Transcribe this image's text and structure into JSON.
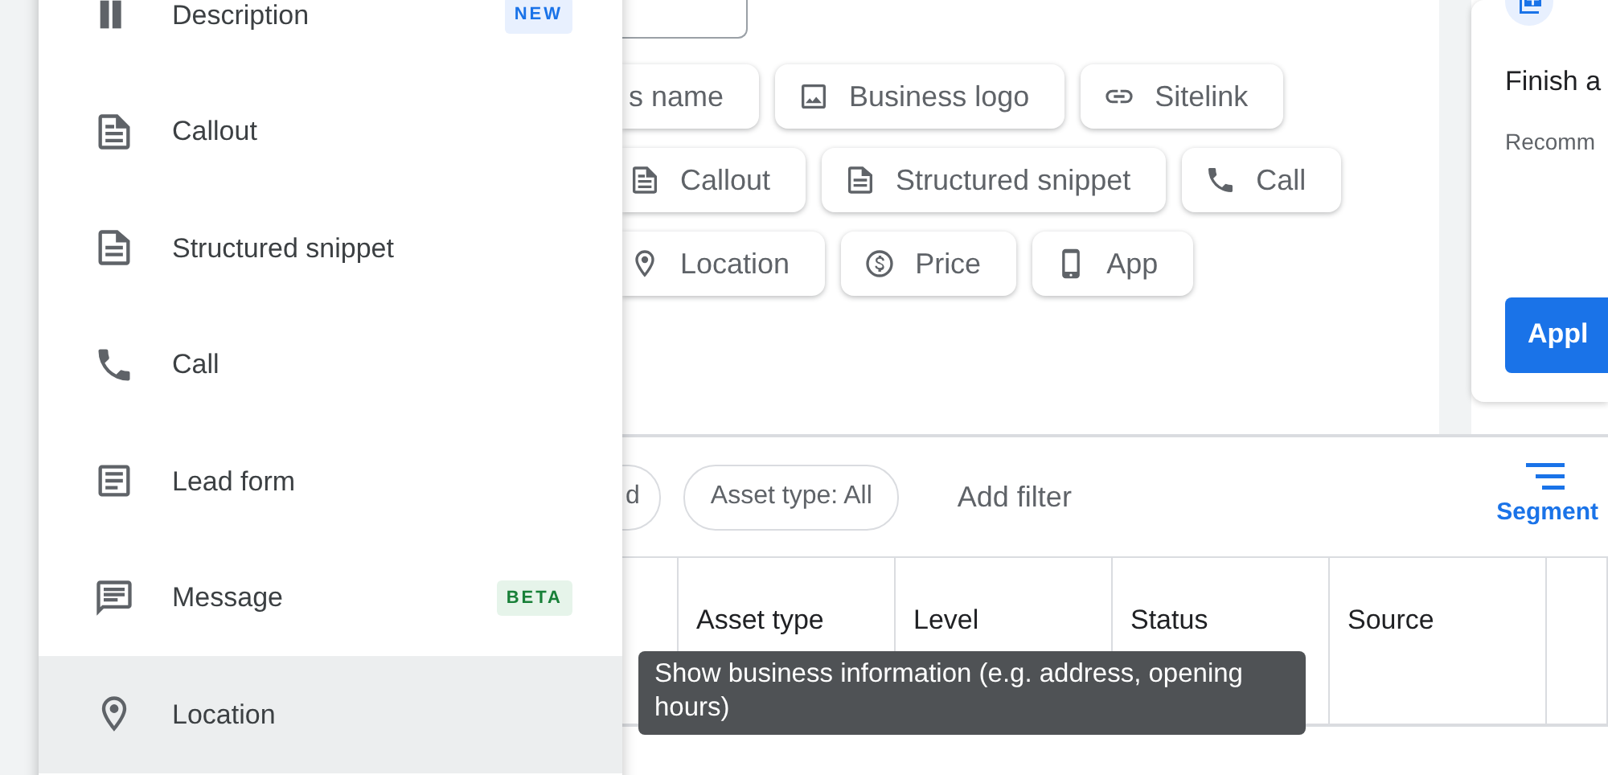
{
  "menu": {
    "items": [
      {
        "label": "Description",
        "badge": "NEW",
        "selected": false
      },
      {
        "label": "Callout",
        "selected": false
      },
      {
        "label": "Structured snippet",
        "selected": false
      },
      {
        "label": "Call",
        "selected": false
      },
      {
        "label": "Lead form",
        "selected": false
      },
      {
        "label": "Message",
        "badge": "BETA",
        "selected": false
      },
      {
        "label": "Location",
        "selected": true
      }
    ]
  },
  "asset_chips": [
    [
      {
        "label": "s name"
      },
      {
        "label": "Business logo"
      },
      {
        "label": "Sitelink"
      }
    ],
    [
      {
        "label": "Callout"
      },
      {
        "label": "Structured snippet"
      },
      {
        "label": "Call"
      }
    ],
    [
      {
        "label": "Location"
      },
      {
        "label": "Price"
      },
      {
        "label": "App"
      }
    ]
  ],
  "side_card": {
    "title": "Finish a",
    "subtitle": "Recomm",
    "button": "Appl"
  },
  "filters": {
    "chips": [
      {
        "label": "d"
      },
      {
        "label": "Asset type: All"
      }
    ],
    "add_filter": "Add filter",
    "segment": "Segment"
  },
  "table": {
    "columns": [
      "",
      "Asset type",
      "Level",
      "Status",
      "Source",
      ""
    ]
  },
  "tooltip": "Show business information (e.g. address, opening hours)"
}
